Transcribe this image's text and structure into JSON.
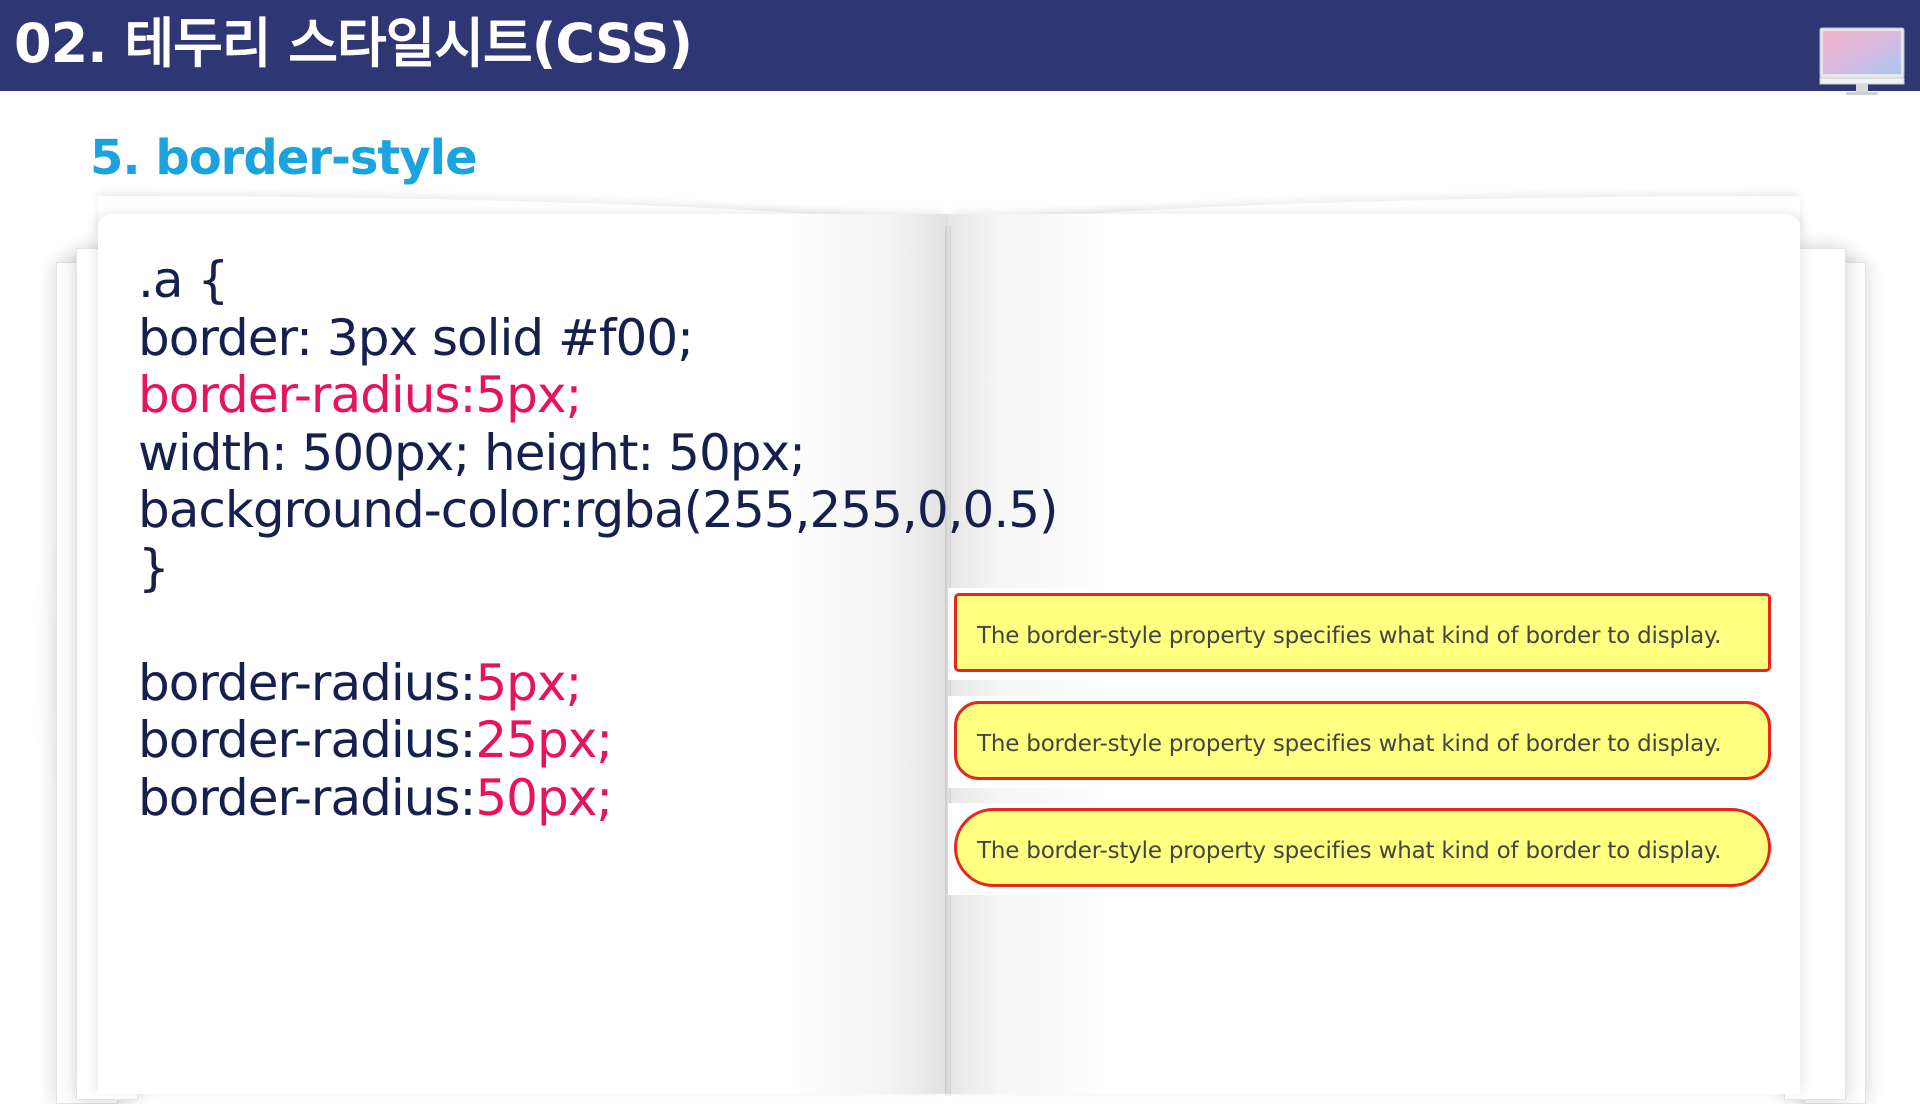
{
  "header": {
    "title": "02. 테두리 스타일시트(CSS)",
    "bar_color": "#2e3673",
    "icon": "monitor-icon"
  },
  "section": {
    "title": "5. border-style",
    "color": "#1aa3df"
  },
  "code": {
    "selector_open": ".a {",
    "border": "border: 3px solid #f00;",
    "radius": "border-radius:5px;",
    "size": "width: 500px; height: 50px;",
    "background": "background-color:rgba(255,255,0,0.5)",
    "close": "}",
    "variants": [
      {
        "prop": "border-radius:",
        "value": "5px;"
      },
      {
        "prop": "border-radius:",
        "value": "25px;"
      },
      {
        "prop": "border-radius:",
        "value": "50px;"
      }
    ],
    "text_color": "#16204f",
    "highlight_color": "#e8135f"
  },
  "demos": [
    {
      "text": "The border-style property specifies what kind of border to display.",
      "radius": "5px"
    },
    {
      "text": "The border-style property specifies what kind of border to display.",
      "radius": "25px"
    },
    {
      "text": "The border-style property specifies what kind of border to display.",
      "radius": "50px"
    }
  ],
  "colors": {
    "demo_fill": "#ffff80",
    "demo_border": "#e8261d"
  }
}
